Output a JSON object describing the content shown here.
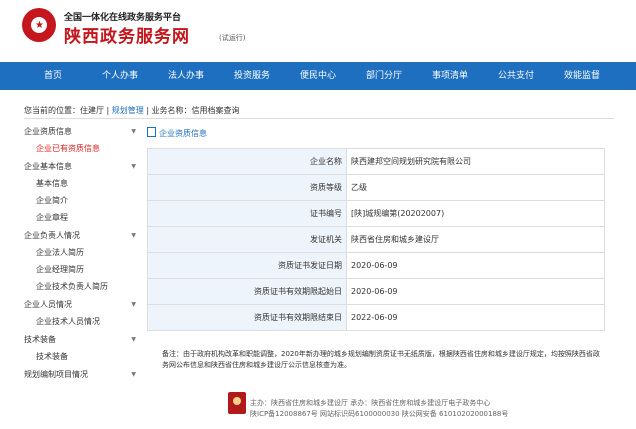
{
  "header": {
    "subtitle": "全国一体化在线政务服务平台",
    "title": "陕西政务服务网",
    "tag": "(试运行)"
  },
  "nav": [
    "首页",
    "个人办事",
    "法人办事",
    "投资服务",
    "便民中心",
    "部门分厅",
    "事项清单",
    "公共支付",
    "效能监督"
  ],
  "breadcrumb": {
    "prefix": "您当前的位置：",
    "home": "住建厅",
    "sep1": " | ",
    "active": "规划管理",
    "sep2": " | ",
    "current": "业务名称：信用档案查询"
  },
  "sidebar": [
    {
      "label": "企业资质信息",
      "chev": true,
      "sub": false,
      "sel": false
    },
    {
      "label": "企业已有资质信息",
      "chev": false,
      "sub": true,
      "sel": true
    },
    {
      "label": "企业基本信息",
      "chev": true,
      "sub": false,
      "sel": false
    },
    {
      "label": "基本信息",
      "chev": false,
      "sub": true,
      "sel": false
    },
    {
      "label": "企业简介",
      "chev": false,
      "sub": true,
      "sel": false
    },
    {
      "label": "企业章程",
      "chev": false,
      "sub": true,
      "sel": false
    },
    {
      "label": "企业负责人情况",
      "chev": true,
      "sub": false,
      "sel": false
    },
    {
      "label": "企业法人简历",
      "chev": false,
      "sub": true,
      "sel": false
    },
    {
      "label": "企业经理简历",
      "chev": false,
      "sub": true,
      "sel": false
    },
    {
      "label": "企业技术负责人简历",
      "chev": false,
      "sub": true,
      "sel": false
    },
    {
      "label": "企业人员情况",
      "chev": true,
      "sub": false,
      "sel": false
    },
    {
      "label": "企业技术人员情况",
      "chev": false,
      "sub": true,
      "sel": false
    },
    {
      "label": "技术装备",
      "chev": true,
      "sub": false,
      "sel": false
    },
    {
      "label": "技术装备",
      "chev": false,
      "sub": true,
      "sel": false
    },
    {
      "label": "规划编制项目情况",
      "chev": true,
      "sub": false,
      "sel": false
    }
  ],
  "tab": "企业资质信息",
  "table": [
    {
      "k": "企业名称",
      "v": "陕西建邦空间规划研究院有限公司"
    },
    {
      "k": "资质等级",
      "v": "乙级"
    },
    {
      "k": "证书编号",
      "v": "[陕]城规编第(20202007)"
    },
    {
      "k": "发证机关",
      "v": "陕西省住房和城乡建设厅"
    },
    {
      "k": "资质证书发证日期",
      "v": "2020-06-09"
    },
    {
      "k": "资质证书有效期限起始日",
      "v": "2020-06-09"
    },
    {
      "k": "资质证书有效期限结束日",
      "v": "2022-06-09"
    }
  ],
  "note": "备注：由于政府机构改革和职能调整，2020年新办理的城乡规划编制资质证书无纸质版，根据陕西省住房和城乡建设厅规定，均按照陕西省政务网公布信息和陕西省住房和城乡建设厅公示信息核查为准。",
  "footer": {
    "line1": "主办：陕西省住房和城乡建设厅 承办：陕西省住房和城乡建设厅电子政务中心",
    "line2": "陕ICP备12008867号 网站标识码6100000030 陕公网安备 61010202000188号"
  }
}
